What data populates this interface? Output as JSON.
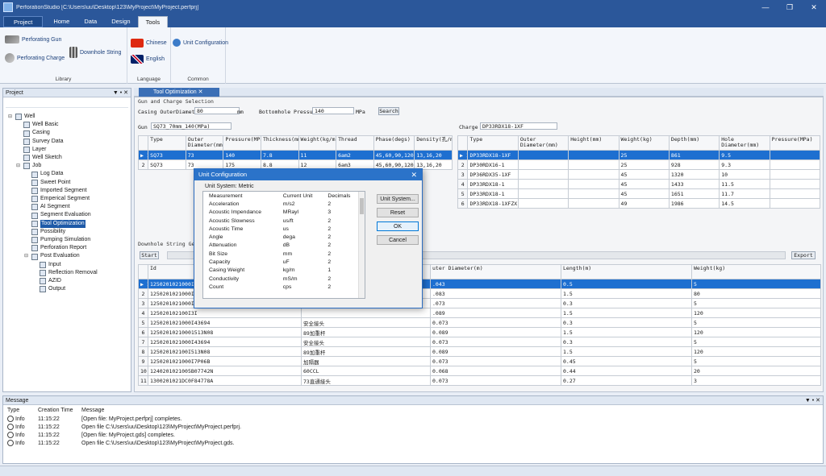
{
  "window": {
    "title": "PerforationStudio [C:\\Users\\uu\\Desktop\\123\\MyProject\\MyProject.perfprj]"
  },
  "ribbon": {
    "tabs": [
      "Project",
      "Home",
      "Data",
      "Design",
      "Tools"
    ],
    "library": {
      "label": "Library",
      "items": [
        "Perforating Gun",
        "Perforating Charge",
        "Downhole String"
      ]
    },
    "language": {
      "label": "Language",
      "items": [
        "Chinese",
        "English"
      ]
    },
    "common": {
      "label": "Common",
      "items": [
        "Unit Configuration"
      ]
    }
  },
  "project_panel": {
    "title": "Project",
    "tree": [
      {
        "label": "Well",
        "level": 0,
        "exp": "-"
      },
      {
        "label": "Well Basic",
        "level": 1
      },
      {
        "label": "Casing",
        "level": 1
      },
      {
        "label": "Survey Data",
        "level": 1
      },
      {
        "label": "Layer",
        "level": 1
      },
      {
        "label": "Well Sketch",
        "level": 1
      },
      {
        "label": "Job",
        "level": 1,
        "exp": "-"
      },
      {
        "label": "Log Data",
        "level": 2
      },
      {
        "label": "Sweet Point",
        "level": 2
      },
      {
        "label": "Imported Segment",
        "level": 2
      },
      {
        "label": "Emperical Segment",
        "level": 2
      },
      {
        "label": "AI Segment",
        "level": 2
      },
      {
        "label": "Segment Evaluation",
        "level": 2
      },
      {
        "label": "Tool Optimization",
        "level": 2,
        "selected": true
      },
      {
        "label": "Possibility",
        "level": 2
      },
      {
        "label": "Pumping Simulation",
        "level": 2
      },
      {
        "label": "Perforation Report",
        "level": 2
      },
      {
        "label": "Post Evaluation",
        "level": 2,
        "exp": "-"
      },
      {
        "label": "Input",
        "level": 3
      },
      {
        "label": "Reflection Removal",
        "level": 3
      },
      {
        "label": "AZID",
        "level": 3
      },
      {
        "label": "Output",
        "level": 3
      }
    ]
  },
  "doc": {
    "tab": "Tool Optimization",
    "section_gun": "Gun and Charge Selection",
    "casing_od_label": "Casing OuterDiameter",
    "casing_od_value": "80",
    "casing_od_unit": "mm",
    "bh_pressure_label": "Bottomhole Pressure",
    "bh_pressure_value": "140",
    "bh_pressure_unit": "MPa",
    "search_button": "Search",
    "gun_label": "Gun",
    "gun_value": "SQ73_70mm_140(MPa)",
    "charge_label": "Charge",
    "charge_value": "DP33RDX18-1XF",
    "gun_table": {
      "headers": [
        "Type",
        "Outer Diameter(mm)",
        "Pressure(MPa)",
        "Thickness(mm)",
        "Weight(kg/m)",
        "Thread",
        "Phase(degs)",
        "Density(孔/m)"
      ],
      "rows": [
        [
          "1",
          "SQ73",
          "73",
          "140",
          "7.8",
          "11",
          "6am2",
          "45,60,90,120",
          "13,16,20"
        ],
        [
          "2",
          "SQ73",
          "73",
          "175",
          "8.8",
          "12",
          "6am3",
          "45,60,90,120",
          "13,16,20"
        ]
      ]
    },
    "charge_table": {
      "headers": [
        "Type",
        "Outer Diameter(mm)",
        "Height(mm)",
        "Weight(kg)",
        "Depth(mm)",
        "Hole Diameter(mm)",
        "Pressure(MPa)"
      ],
      "rows": [
        [
          "1",
          "DP33RDX18-1XF",
          "",
          "",
          "25",
          "861",
          "9.5",
          ""
        ],
        [
          "2",
          "DP30RDX16-1",
          "",
          "",
          "25",
          "928",
          "9.3",
          ""
        ],
        [
          "3",
          "DP36RDX35-1XF",
          "",
          "",
          "45",
          "1320",
          "10",
          ""
        ],
        [
          "4",
          "DP33RDX18-1",
          "",
          "",
          "45",
          "1433",
          "11.5",
          ""
        ],
        [
          "5",
          "DP33RDX18-1",
          "",
          "",
          "45",
          "1651",
          "11.7",
          ""
        ],
        [
          "6",
          "DP33RDX18-1XFZX",
          "",
          "",
          "49",
          "1986",
          "14.5",
          ""
        ]
      ]
    },
    "section_string": "Downhole String Gene",
    "start_button": "Start",
    "export_button": "Export",
    "string_table": {
      "headers": [
        "Id",
        "",
        "uter Diameter(m)",
        "Length(m)",
        "Weight(kg)"
      ],
      "rows": [
        [
          "1",
          "1250201021000I3D",
          "",
          ".043",
          "0.5",
          "5"
        ],
        [
          "2",
          "1250201021000I3I",
          "",
          ".083",
          "1.5",
          "80"
        ],
        [
          "3",
          "1250201021000I3I",
          "",
          ".073",
          "0.3",
          "5"
        ],
        [
          "4",
          "125020102100I3I",
          "",
          ".089",
          "1.5",
          "120"
        ],
        [
          "5",
          "1250201021000I43694",
          "安全接头",
          "0.073",
          "0.3",
          "5"
        ],
        [
          "6",
          "12502010210001513N08",
          "89加重杆",
          "0.089",
          "1.5",
          "120"
        ],
        [
          "7",
          "1250201021000I43694",
          "安全接头",
          "0.073",
          "0.3",
          "5"
        ],
        [
          "8",
          "125020102100I513N08",
          "89加重杆",
          "0.089",
          "1.5",
          "120"
        ],
        [
          "9",
          "1250201021000I7P06B",
          "加隔器",
          "0.073",
          "0.45",
          "5"
        ],
        [
          "10",
          "1240201021005B07742N",
          "60CCL",
          "0.068",
          "0.44",
          "20"
        ],
        [
          "11",
          "1300201021DC0F84778A",
          "73直通接头",
          "0.073",
          "0.27",
          "3"
        ]
      ]
    }
  },
  "dialog": {
    "title": "Unit Configuration",
    "unit_system_label": "Unit System: Metric",
    "headers": [
      "Measurement",
      "Current Unit",
      "Decimals"
    ],
    "rows": [
      [
        "Acceleration",
        "m/s2",
        "2"
      ],
      [
        "Acoustic Impendance",
        "MRayl",
        "3"
      ],
      [
        "Acoustic Slowness",
        "us/ft",
        "2"
      ],
      [
        "Acoustic Time",
        "us",
        "2"
      ],
      [
        "Angle",
        "dega",
        "2"
      ],
      [
        "Attenuation",
        "dB",
        "2"
      ],
      [
        "Bit Size",
        "mm",
        "2"
      ],
      [
        "Capacity",
        "uF",
        "2"
      ],
      [
        "Casing Weight",
        "kg/m",
        "1"
      ],
      [
        "Conductivity",
        "mS/m",
        "2"
      ],
      [
        "Count",
        "cps",
        "2"
      ]
    ],
    "buttons": {
      "unit_system": "Unit System...",
      "reset": "Reset",
      "ok": "OK",
      "cancel": "Cancel"
    }
  },
  "message_panel": {
    "title": "Message",
    "headers": [
      "Type",
      "Creation Time",
      "Message"
    ],
    "rows": [
      [
        "Info",
        "11:15:22",
        "[Open file: MyProject.perfprj] completes."
      ],
      [
        "Info",
        "11:15:22",
        "Open file C:\\Users\\uu\\Desktop\\123\\MyProject\\MyProject.perfprj."
      ],
      [
        "Info",
        "11:15:22",
        "[Open file: MyProject.gds] completes."
      ],
      [
        "Info",
        "11:15:22",
        "Open file C:\\Users\\uu\\Desktop\\123\\MyProject\\MyProject.gds."
      ]
    ]
  },
  "colors": {
    "accent": "#2b579a",
    "selection": "#1e6fd0"
  }
}
